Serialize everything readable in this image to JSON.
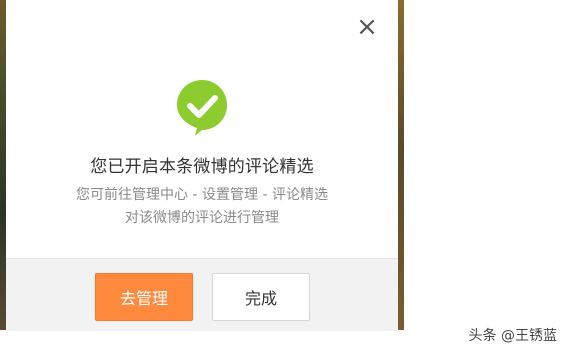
{
  "dialog": {
    "close_icon": "×",
    "success_icon": "check-bubble-icon",
    "title": "您已开启本条微博的评论精选",
    "desc_line1": "您可前往管理中心 - 设置管理 - 评论精选",
    "desc_line2": "对该微博的评论进行管理",
    "buttons": {
      "manage_label": "去管理",
      "done_label": "完成"
    }
  },
  "watermark": {
    "text": "头条 @王锈蓝"
  },
  "colors": {
    "accent_orange": "#ff8a3d",
    "success_green": "#8ccc2f"
  }
}
